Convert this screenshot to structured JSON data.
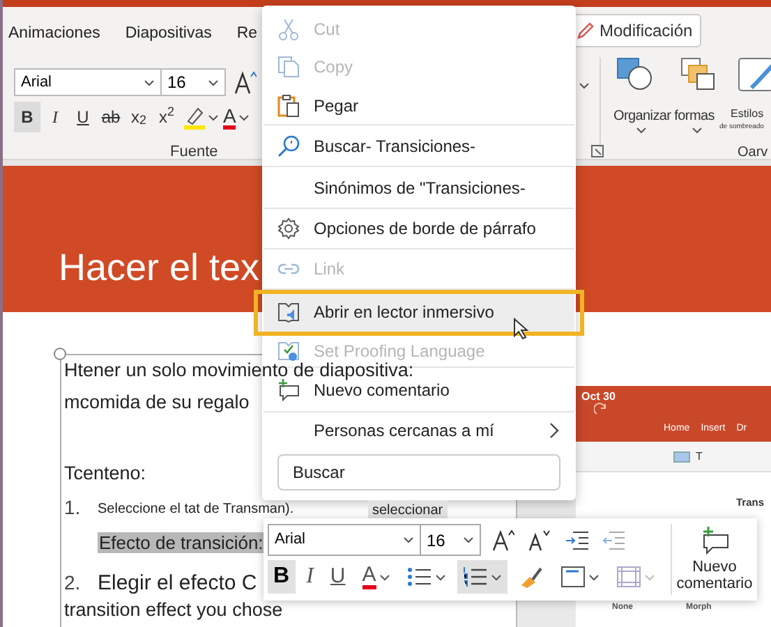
{
  "ribbon": {
    "tabs": [
      {
        "label": "Animaciones",
        "selected": false
      },
      {
        "label": "Diapositivas",
        "selected": false
      },
      {
        "label": "Re",
        "selected": false
      }
    ],
    "edit_button": "Modificación",
    "font_name": "Arial",
    "font_size": "16",
    "format_buttons": [
      {
        "kind": "text",
        "label": "B",
        "selected": true
      },
      {
        "kind": "text",
        "label": "I",
        "selected": false
      },
      {
        "kind": "text",
        "label": "U",
        "selected": false
      },
      {
        "kind": "text",
        "label": "ab",
        "selected": false
      },
      {
        "kind": "text",
        "label": "x$_{2}$",
        "selected": false
      },
      {
        "kind": "text",
        "label": "x$^{2}$",
        "selected": false
      },
      {
        "kind": "highlight",
        "selected": false
      },
      {
        "kind": "fontcolor",
        "label": "A",
        "selected": false
      }
    ],
    "font_group_label": "Fuente",
    "arrange_label": "Organizar formas",
    "styles_label": "Estilos",
    "styles_sublabel": "de sombreado",
    "drawing_group_label": "Oarv"
  },
  "slide": {
    "title": "Hacer el tex",
    "lines": [
      {
        "kind": "para",
        "text": "Htener un solo movimiento de diapositiva:"
      },
      {
        "kind": "para",
        "text": "mcomida de su regalo"
      },
      {
        "kind": "gap"
      },
      {
        "kind": "para",
        "text": "Tcenteno:"
      },
      {
        "kind": "numbered",
        "number": "1.",
        "text": "Seleccione el tat de Transman)."
      },
      {
        "kind": "highlighted",
        "text": "Efecto de transición:"
      },
      {
        "kind": "numbered",
        "number": "2.",
        "text": "Elegir el efecto C"
      },
      {
        "kind": "para",
        "text": "transition effect you chose"
      }
    ]
  },
  "context_menu": {
    "items": [
      {
        "kind": "cut",
        "label": "Cut",
        "disabled": true,
        "selected": false,
        "divider": false,
        "submenu": false
      },
      {
        "kind": "copy",
        "label": "Copy",
        "disabled": true,
        "selected": false,
        "divider": false,
        "submenu": false
      },
      {
        "kind": "paste",
        "label": "Pegar",
        "disabled": false,
        "selected": false,
        "divider": true,
        "submenu": false
      },
      {
        "kind": "search",
        "label": "Buscar- Transiciones-",
        "disabled": false,
        "selected": false,
        "divider": true,
        "submenu": false
      },
      {
        "kind": "plain",
        "label": "Sinónimos de \"Transiciones-",
        "disabled": false,
        "selected": false,
        "divider": true,
        "submenu": false
      },
      {
        "kind": "gear",
        "label": "Opciones de borde de párrafo",
        "disabled": false,
        "selected": false,
        "divider": true,
        "submenu": false
      },
      {
        "kind": "link",
        "label": "Link",
        "disabled": true,
        "selected": false,
        "divider": true,
        "submenu": false
      },
      {
        "kind": "reader",
        "label": "Abrir en lector inmersivo",
        "disabled": false,
        "selected": true,
        "divider": false,
        "submenu": false
      },
      {
        "kind": "proofing",
        "label": "Set Proofing Language",
        "disabled": true,
        "selected": false,
        "divider": true,
        "submenu": false
      },
      {
        "kind": "comment",
        "label": "Nuevo comentario",
        "disabled": false,
        "selected": false,
        "divider": true,
        "submenu": false
      },
      {
        "kind": "plain",
        "label": "Personas cercanas a mí",
        "disabled": false,
        "selected": false,
        "divider": false,
        "submenu": true
      }
    ],
    "search": {
      "placeholder": "Buscar"
    }
  },
  "selection_tag": "seleccionar",
  "mini_toolbar": {
    "font_name": "Arial",
    "font_size": "16",
    "format_buttons": [
      {
        "kind": "bold",
        "label": "B",
        "selected": true
      },
      {
        "kind": "italic",
        "label": "I",
        "selected": false
      },
      {
        "kind": "underline",
        "label": "U",
        "selected": false
      },
      {
        "kind": "fontcolor",
        "label": "A",
        "selected": false
      },
      {
        "kind": "bullets",
        "selected": false
      },
      {
        "kind": "numbering",
        "selected": true
      },
      {
        "kind": "brush",
        "selected": false
      },
      {
        "kind": "textbox",
        "selected": false
      },
      {
        "kind": "table",
        "selected": false
      }
    ],
    "comment_button": "Nuevo comentario"
  },
  "embedded_screenshot": {
    "date": "Oct 30",
    "tabs": [
      "Home",
      "Insert",
      "Dr"
    ],
    "toolbar_text": "T",
    "heading": "Trans",
    "thumbnails": [
      "None",
      "Morph"
    ]
  }
}
